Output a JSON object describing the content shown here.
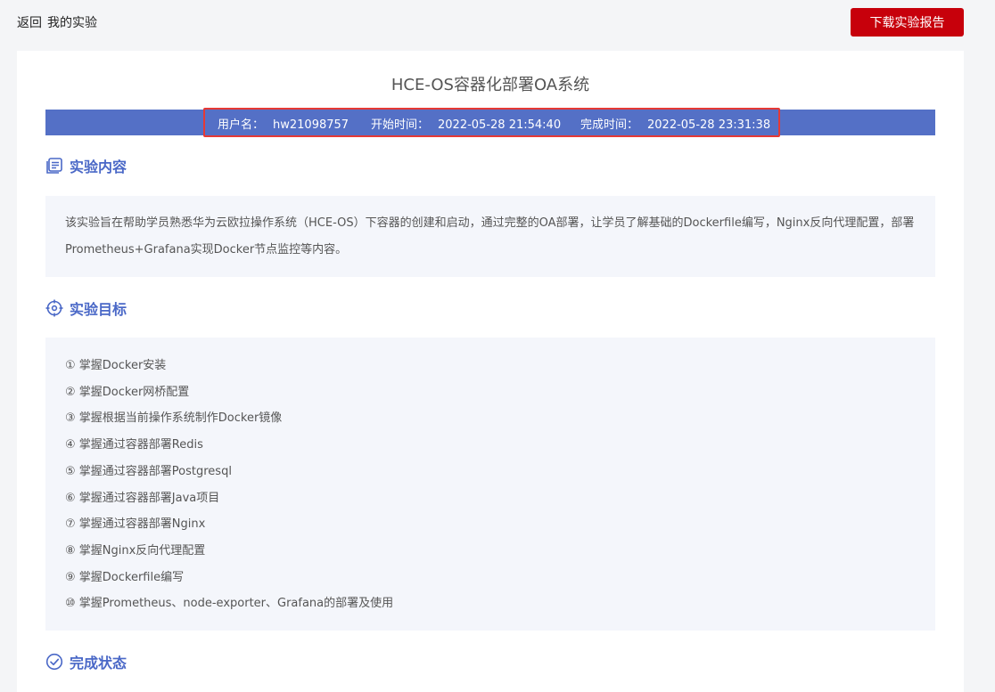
{
  "topbar": {
    "back_label": "返回",
    "page_name": "我的实验",
    "download_label": "下载实验报告"
  },
  "experiment": {
    "title": "HCE-OS容器化部署OA系统",
    "username_label": "用户名：",
    "username": "hw21098757",
    "start_label": "开始时间：",
    "start_time": "2022-05-28 21:54:40",
    "finish_label": "完成时间：",
    "finish_time": "2022-05-28 23:31:38"
  },
  "sections": {
    "content": {
      "title": "实验内容",
      "icon": "document-list-icon",
      "text": "该实验旨在帮助学员熟悉华为云欧拉操作系统（HCE-OS）下容器的创建和启动，通过完整的OA部署，让学员了解基础的Dockerfile编写，Nginx反向代理配置，部署Prometheus+Grafana实现Docker节点监控等内容。"
    },
    "goals": {
      "title": "实验目标",
      "icon": "target-icon",
      "items": [
        "① 掌握Docker安装",
        "② 掌握Docker网桥配置",
        "③ 掌握根据当前操作系统制作Docker镜像",
        "④ 掌握通过容器部署Redis",
        "⑤ 掌握通过容器部署Postgresql",
        "⑥ 掌握通过容器部署Java项目",
        "⑦ 掌握通过容器部署Nginx",
        "⑧ 掌握Nginx反向代理配置",
        "⑨ 掌握Dockerfile编写",
        "⑩ 掌握Prometheus、node-exporter、Grafana的部署及使用"
      ]
    },
    "status": {
      "title": "完成状态",
      "icon": "check-circle-icon"
    }
  },
  "colors": {
    "accent": "#4a68c7",
    "info_bar": "#5470c6",
    "download_button": "#c7000b",
    "highlight": "#e53935"
  }
}
